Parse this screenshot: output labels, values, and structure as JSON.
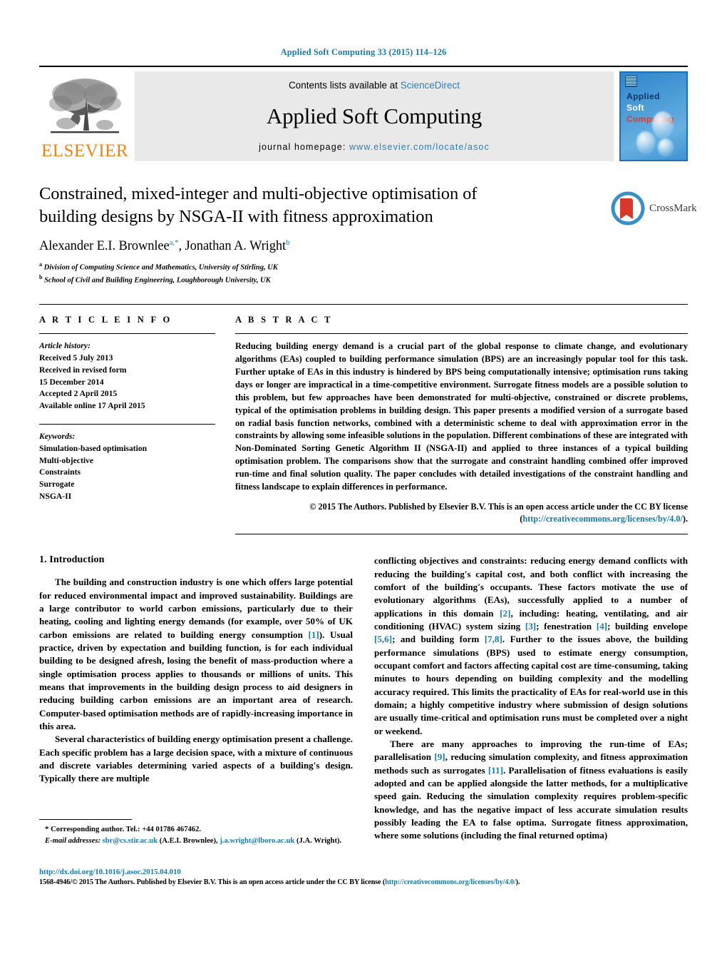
{
  "running_head": "Applied Soft Computing 33 (2015) 114–126",
  "masthead": {
    "publisher_name": "ELSEVIER",
    "contents_prefix": "Contents lists available at ",
    "contents_link": "ScienceDirect",
    "journal_title": "Applied Soft Computing",
    "homepage_prefix": "journal homepage: ",
    "homepage_url": "www.elsevier.com/locate/asoc",
    "cover": {
      "line1": "Applied",
      "line2": "Soft",
      "line3": "Computing"
    }
  },
  "title_block": {
    "title": "Constrained, mixed-integer and multi-objective optimisation of building designs by NSGA-II with fitness approximation",
    "author1": "Alexander E.I. Brownlee",
    "author1_sup": "a,*",
    "author_separator": ", ",
    "author2": "Jonathan A. Wright",
    "author2_sup": "b",
    "affiliation_a_marker": "a",
    "affiliation_a": "Division of Computing Science and Mathematics, University of Stirling, UK",
    "affiliation_b_marker": "b",
    "affiliation_b": "School of Civil and Building Engineering, Loughborough University, UK",
    "crossmark_label": "CrossMark"
  },
  "article_info": {
    "heading": "A R T I C L E  I N F O",
    "history_label": "Article history:",
    "history": [
      "Received 5 July 2013",
      "Received in revised form",
      "15 December 2014",
      "Accepted 2 April 2015",
      "Available online 17 April 2015"
    ],
    "keywords_label": "Keywords:",
    "keywords": [
      "Simulation-based optimisation",
      "Multi-objective",
      "Constraints",
      "Surrogate",
      "NSGA-II"
    ]
  },
  "abstract": {
    "heading": "A B S T R A C T",
    "text": "Reducing building energy demand is a crucial part of the global response to climate change, and evolutionary algorithms (EAs) coupled to building performance simulation (BPS) are an increasingly popular tool for this task. Further uptake of EAs in this industry is hindered by BPS being computationally intensive; optimisation runs taking days or longer are impractical in a time-competitive environment. Surrogate fitness models are a possible solution to this problem, but few approaches have been demonstrated for multi-objective, constrained or discrete problems, typical of the optimisation problems in building design. This paper presents a modified version of a surrogate based on radial basis function networks, combined with a deterministic scheme to deal with approximation error in the constraints by allowing some infeasible solutions in the population. Different combinations of these are integrated with Non-Dominated Sorting Genetic Algorithm II (NSGA-II) and applied to three instances of a typical building optimisation problem. The comparisons show that the surrogate and constraint handling combined offer improved run-time and final solution quality. The paper concludes with detailed investigations of the constraint handling and fitness landscape to explain differences in performance.",
    "copyright": "© 2015 The Authors. Published by Elsevier B.V. This is an open access article under the CC BY license",
    "license_open": "(",
    "license_url": "http://creativecommons.org/licenses/by/4.0/",
    "license_close": ")."
  },
  "body": {
    "section_heading": "1.  Introduction",
    "left_paragraphs": [
      {
        "parts": [
          {
            "t": "The building and construction industry is one which offers large potential for reduced environmental impact and improved sustainability. Buildings are a large contributor to world carbon emissions, particularly due to their heating, cooling and lighting energy demands (for example, over 50% of UK carbon emissions are related to building energy consumption "
          },
          {
            "t": "[1]",
            "link": true
          },
          {
            "t": "). Usual practice, driven by expectation and building function, is for each individual building to be designed afresh, losing the benefit of mass-production where a single optimisation process applies to thousands or millions of units. This means that improvements in the building design process to aid designers in reducing building carbon emissions are an important area of research. Computer-based optimisation methods are of rapidly-increasing importance in this area."
          }
        ]
      },
      {
        "parts": [
          {
            "t": "Several characteristics of building energy optimisation present a challenge. Each specific problem has a large decision space, with a mixture of continuous and discrete variables determining varied aspects of a building's design. Typically there are multiple"
          }
        ]
      }
    ],
    "right_paragraphs": [
      {
        "parts": [
          {
            "t": "conflicting objectives and constraints: reducing energy demand conflicts with reducing the building's capital cost, and both conflict with increasing the comfort of the building's occupants. These factors motivate the use of evolutionary algorithms (EAs), successfully applied to a number of applications in this domain "
          },
          {
            "t": "[2]",
            "link": true
          },
          {
            "t": ", including: heating, ventilating, and air conditioning (HVAC) system sizing "
          },
          {
            "t": "[3]",
            "link": true
          },
          {
            "t": "; fenestration "
          },
          {
            "t": "[4]",
            "link": true
          },
          {
            "t": "; building envelope "
          },
          {
            "t": "[5,6]",
            "link": true
          },
          {
            "t": "; and building form "
          },
          {
            "t": "[7,8]",
            "link": true
          },
          {
            "t": ". Further to the issues above, the building performance simulations (BPS) used to estimate energy consumption, occupant comfort and factors affecting capital cost are time-consuming, taking minutes to hours depending on building complexity and the modelling accuracy required. This limits the practicality of EAs for real-world use in this domain; a highly competitive industry where submission of design solutions are usually time-critical and optimisation runs must be completed over a night or weekend."
          }
        ]
      },
      {
        "parts": [
          {
            "t": "There are many approaches to improving the run-time of EAs; parallelisation "
          },
          {
            "t": "[9]",
            "link": true
          },
          {
            "t": ", reducing simulation complexity, and fitness approximation methods such as surrogates "
          },
          {
            "t": "[11]",
            "link": true
          },
          {
            "t": ". Parallelisation of fitness evaluations is easily adopted and can be applied alongside the latter methods, for a multiplicative speed gain. Reducing the simulation complexity requires problem-specific knowledge, and has the negative impact of less accurate simulation results possibly leading the EA to false optima. Surrogate fitness approximation, where some solutions (including the final returned optima)"
          }
        ]
      }
    ]
  },
  "footnotes": {
    "corresponding_marker": "*",
    "corresponding": "Corresponding author. Tel.: +44 01786 467462.",
    "email_label": "E-mail addresses:",
    "email1": "sbr@cs.stir.ac.uk",
    "email1_owner": "(A.E.I. Brownlee),",
    "email2": "j.a.wright@lboro.ac.uk",
    "email2_owner": "(J.A. Wright)."
  },
  "page_footer": {
    "doi": "http://dx.doi.org/10.1016/j.asoc.2015.04.010",
    "issn_text": "1568-4946/© 2015 The Authors. Published by Elsevier B.V. This is an open access article under the CC BY license (",
    "issn_link": "http://creativecommons.org/licenses/by/4.0/",
    "issn_tail": ")."
  },
  "colors": {
    "link": "#1a7aa8",
    "elsevier_orange": "#ee8219",
    "cover_blue": "#2f86cd"
  }
}
